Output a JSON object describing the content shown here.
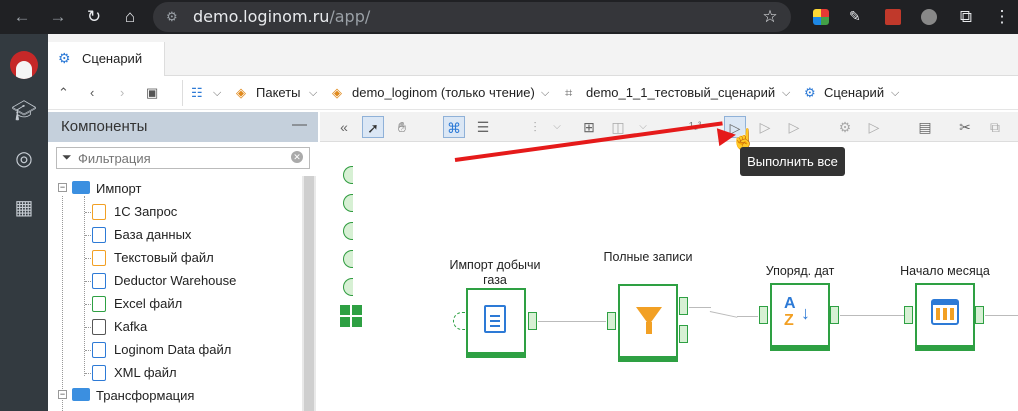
{
  "browser": {
    "url_host": "demo.loginom.ru",
    "url_path": "/app/"
  },
  "tab": {
    "label": "Сценарий"
  },
  "breadcrumbs": [
    {
      "label": "Пакеты"
    },
    {
      "label": "demo_loginom (только чтение)"
    },
    {
      "label": "demo_1_1_тестовый_сценарий"
    },
    {
      "label": "Сценарий"
    }
  ],
  "components_panel": {
    "title": "Компоненты",
    "collapse": "—",
    "filter_placeholder": "Фильтрация",
    "groups": [
      {
        "label": "Импорт",
        "items": [
          {
            "label": "1С Запрос"
          },
          {
            "label": "База данных"
          },
          {
            "label": "Текстовый файл"
          },
          {
            "label": "Deductor Warehouse"
          },
          {
            "label": "Excel файл"
          },
          {
            "label": "Kafka"
          },
          {
            "label": "Loginom Data файл"
          },
          {
            "label": "XML файл"
          }
        ]
      },
      {
        "label": "Трансформация",
        "items": []
      }
    ]
  },
  "tooltip": {
    "text": "Выполнить все"
  },
  "nodes": [
    {
      "label": "Импорт добычи газа"
    },
    {
      "label": "Полные записи"
    },
    {
      "label": "Упоряд. дат"
    },
    {
      "label": "Начало месяца"
    }
  ],
  "colors": {
    "node_green": "#2ea043",
    "arrow_red": "#e51a1a",
    "panel_header": "#c5d0dc",
    "rail": "#333a40"
  }
}
